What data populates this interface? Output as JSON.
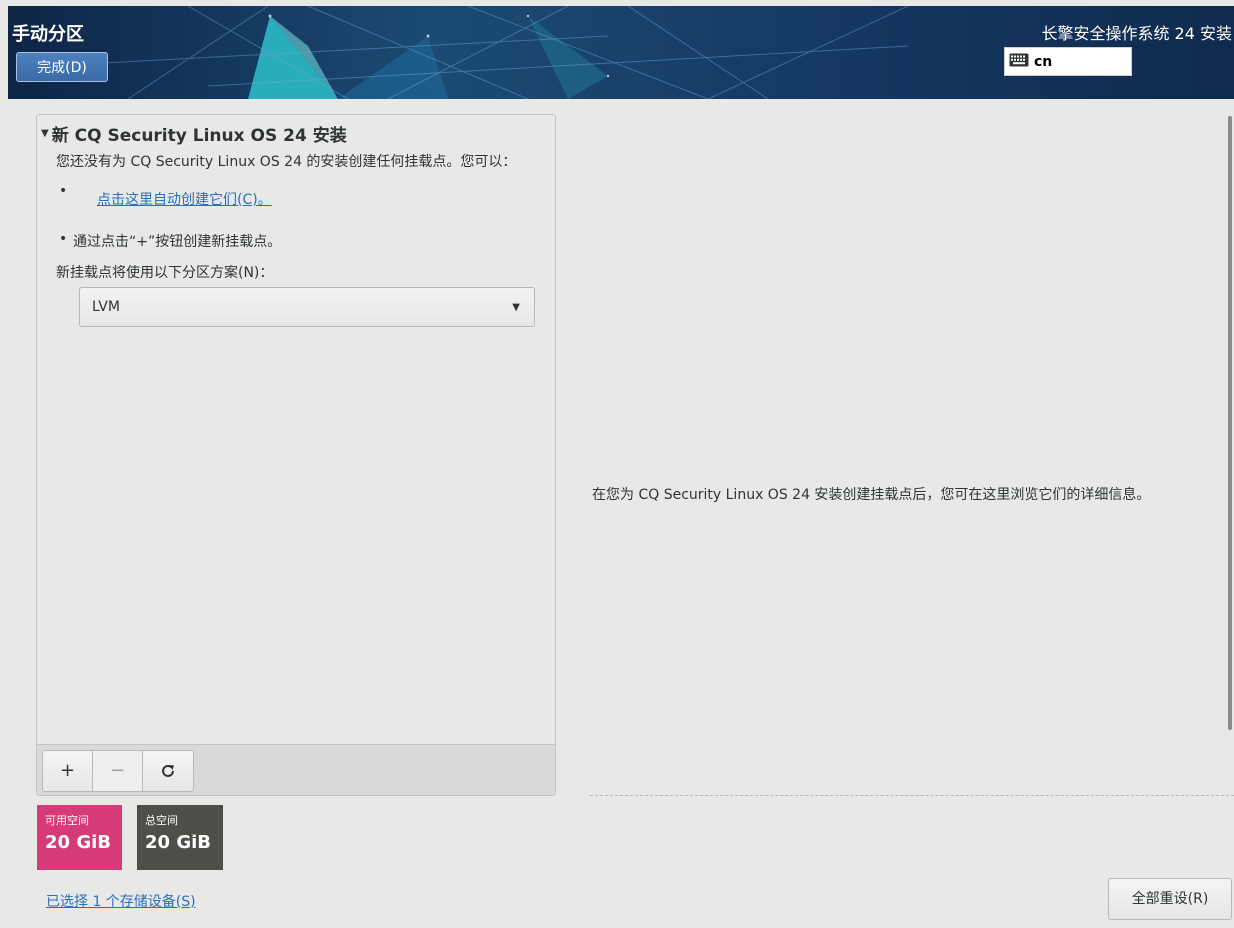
{
  "header": {
    "page_title": "手动分区",
    "done_button": "完成(D)",
    "product_title": "长擎安全操作系统 24 安装",
    "keyboard_layout": "cn",
    "keyboard_icon": "keyboard-icon"
  },
  "left_panel": {
    "section_title": "新 CQ Security Linux OS 24 安装",
    "description": "您还没有为 CQ Security Linux OS 24 的安装创建任何挂载点。您可以：",
    "bullet": "•",
    "auto_create_link": "点击这里自动创建它们(C)。",
    "manual_create_text": "通过点击“+”按钮创建新挂载点。",
    "scheme_label": "新挂载点将使用以下分区方案(N)：",
    "scheme_value": "LVM",
    "toolbar": {
      "add": "+",
      "remove": "−",
      "refresh": "⟳"
    }
  },
  "space": {
    "available_label": "可用空间",
    "available_value": "20 GiB",
    "total_label": "总空间",
    "total_value": "20 GiB"
  },
  "storage_link": "已选择 1 个存储设备(S)",
  "right_panel": {
    "info_text": "在您为 CQ Security Linux OS 24 安装创建挂载点后，您可在这里浏览它们的详细信息。"
  },
  "reset_button": "全部重设(R)",
  "colors": {
    "header_bg": "#0f2a4d",
    "accent": "#2bb3c0",
    "available_space": "#d63a77",
    "total_space": "#4e4f4b",
    "link": "#2a6fbf"
  }
}
